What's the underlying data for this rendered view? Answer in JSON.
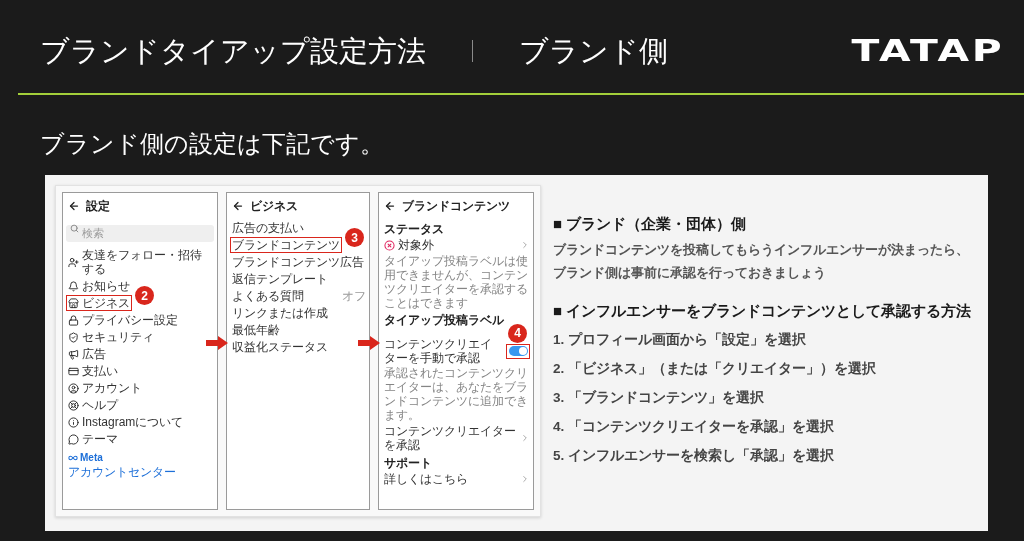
{
  "header": {
    "title": "ブランドタイアップ設定方法",
    "subtitle": "ブランド側",
    "logo": "TATAP"
  },
  "intro": "ブランド側の設定は下記です。",
  "screens": [
    {
      "title": "設定",
      "rows": [
        {
          "kind": "search",
          "placeholder": "検索"
        },
        {
          "kind": "icon-item",
          "label": "友達をフォロー・招待する",
          "highlighted": false
        },
        {
          "kind": "icon-item",
          "label": "お知らせ",
          "highlighted": false
        },
        {
          "kind": "icon-item",
          "label": "ビジネス",
          "highlighted": true,
          "step": "2"
        },
        {
          "kind": "icon-item",
          "label": "プライバシー設定",
          "highlighted": false
        },
        {
          "kind": "icon-item",
          "label": "セキュリティ",
          "highlighted": false
        },
        {
          "kind": "icon-item",
          "label": "広告",
          "highlighted": false
        },
        {
          "kind": "icon-item",
          "label": "支払い",
          "highlighted": false
        },
        {
          "kind": "icon-item",
          "label": "アカウント",
          "highlighted": false
        },
        {
          "kind": "icon-item",
          "label": "ヘルプ",
          "highlighted": false
        },
        {
          "kind": "icon-item",
          "label": "Instagramについて",
          "highlighted": false
        },
        {
          "kind": "icon-item",
          "label": "テーマ",
          "highlighted": false
        },
        {
          "kind": "brand",
          "label": "Meta"
        },
        {
          "kind": "link",
          "label": "アカウントセンター"
        }
      ]
    },
    {
      "title": "ビジネス",
      "rows": [
        {
          "kind": "item",
          "label": "広告の支払い",
          "highlighted": false
        },
        {
          "kind": "item",
          "label": "ブランドコンテンツ",
          "highlighted": true,
          "step": "3"
        },
        {
          "kind": "item",
          "label": "ブランドコンテンツ広告",
          "highlighted": false
        },
        {
          "kind": "item",
          "label": "返信テンプレート",
          "highlighted": false
        },
        {
          "kind": "item",
          "label": "よくある質問",
          "value": "オフ",
          "highlighted": false
        },
        {
          "kind": "item",
          "label": "リンクまたは作成",
          "highlighted": false
        },
        {
          "kind": "item",
          "label": "最低年齢",
          "highlighted": false
        },
        {
          "kind": "item",
          "label": "収益化ステータス",
          "highlighted": false
        }
      ]
    },
    {
      "title": "ブランドコンテンツ",
      "rows": [
        {
          "kind": "section",
          "label": "ステータス"
        },
        {
          "kind": "status",
          "label": "対象外",
          "highlighted": false
        },
        {
          "kind": "note",
          "label": "タイアップ投稿ラベルは使用できませんが、コンテンツクリエイターを承認することはできます"
        },
        {
          "kind": "section",
          "label": "タイアップ投稿ラベル"
        },
        {
          "kind": "toggle",
          "label": "コンテンツクリエイターを手動で承認",
          "on": true,
          "highlighted": true,
          "step": "4"
        },
        {
          "kind": "note",
          "label": "承認されたコンテンツクリエイターは、あなたをブランドコンテンツに追加できます。"
        },
        {
          "kind": "link-item",
          "label": "コンテンツクリエイターを承認",
          "highlighted": false
        },
        {
          "kind": "section",
          "label": "サポート"
        },
        {
          "kind": "link-item",
          "label": "詳しくはこちら",
          "highlighted": false
        }
      ]
    }
  ],
  "instructions": {
    "sections": [
      {
        "heading": "■ ブランド（企業・団体）側",
        "body_lines": [
          "ブランドコンテンツを投稿してもらうインフルエンサーが決まったら、",
          "ブランド側は事前に承認を行っておきましょう"
        ]
      },
      {
        "heading": "■ インフルエンサーをブランドコンテンツとして承認する方法",
        "steps": [
          "1. プロフィール画面から「設定」を選択",
          "2. 「ビジネス」（または「クリエイター」）を選択",
          "3. 「ブランドコンテンツ」を選択",
          "4. 「コンテンツクリエイターを承認」を選択",
          "5. インフルエンサーを検索し「承認」を選択"
        ]
      }
    ]
  }
}
